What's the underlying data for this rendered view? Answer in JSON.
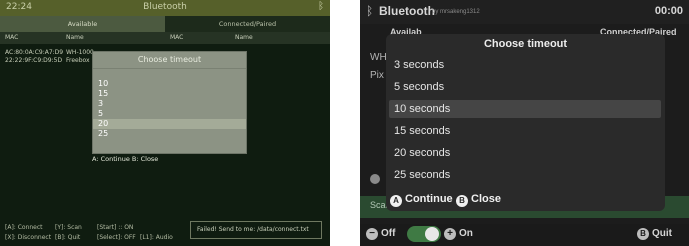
{
  "left": {
    "header": {
      "time": "22:24",
      "title": "Bluetooth",
      "bt_icon": "bluetooth-icon"
    },
    "tabs": {
      "available": "Available",
      "connected": "Connected/Paired"
    },
    "columns": {
      "mac_left": "MAC",
      "name_left": "Name",
      "mac_right": "MAC",
      "name_right": "Name"
    },
    "devices": [
      {
        "mac": "AC:80:0A:C9:A7:D9",
        "name": "WH-1000..."
      },
      {
        "mac": "22:22:9F:C9:D9:5D",
        "name": "Freebox (..."
      }
    ],
    "modal": {
      "title": "Choose timeout",
      "options": [
        "10",
        "15",
        "3",
        "5",
        "20",
        "25"
      ],
      "selected_index": 4,
      "hint": "A: Continue   B: Close"
    },
    "footer": {
      "connect": "[A]: Connect",
      "scan": "[Y]: Scan",
      "start": "[Start]  :: ON",
      "disconnect": "[X]: Disconnect",
      "quit": "[B]: Quit",
      "select": "[Select]: OFF",
      "audio": "[L1]: Audio"
    },
    "message": "Failed! Send to me: /data/connect.txt",
    "colors": {
      "bg": "#0f1c10",
      "header": "#56602a",
      "modal": "#8c9384"
    }
  },
  "right": {
    "header": {
      "title": "Bluetooth",
      "by": "by mrsakeng1312",
      "clock": "00:00",
      "bt_icon": "bluetooth-icon"
    },
    "peek": {
      "tab_left": "Availab",
      "tab_right": "Connected/Paired",
      "row1": "WH",
      "row2": "Pix",
      "scan": "Scan"
    },
    "modal": {
      "title": "Choose timeout",
      "options": [
        "3 seconds",
        "5 seconds",
        "10 seconds",
        "15 seconds",
        "20 seconds",
        "25 seconds"
      ],
      "selected_index": 2,
      "continue_key": "A",
      "continue_label": "Continue",
      "close_key": "B",
      "close_label": "Close"
    },
    "footer": {
      "minus": "−",
      "off": "Off",
      "plus": "+",
      "on": "On",
      "b_key": "B",
      "quit": "Quit"
    },
    "colors": {
      "bg": "#1c1c1c",
      "modal": "#2a2a2a",
      "selected": "#454545",
      "toggle": "#3f7a44"
    }
  }
}
